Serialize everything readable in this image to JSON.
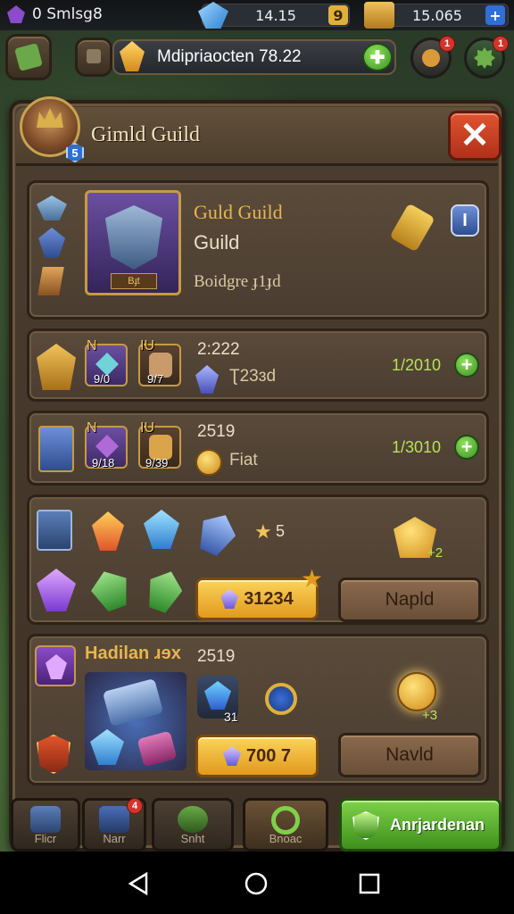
{
  "status_bar": {
    "left_text": "0 Smlsg8",
    "gems": "14.15",
    "gold": "15.065",
    "gem_plus": "9",
    "gold_plus": "+"
  },
  "top_banner": {
    "text": "Mdipriaocten 78.22"
  },
  "badges": {
    "mail": "1",
    "settings": "1"
  },
  "panel": {
    "title": "Gimld Guild",
    "avatar_level": "5",
    "close_label": "✕"
  },
  "guild_card": {
    "name": "Guld Guild",
    "type": "Guild",
    "badge_text": "Boidgre ɟ1ɟd",
    "emblem_label": "Bɟt",
    "info_label": "I"
  },
  "row1": {
    "item1_count": "9/0",
    "item2_count": "9/7",
    "item1_top": "N",
    "item2_top": "IU",
    "amount": "2:222",
    "sub": "Ʈ23ɜd",
    "progress": "1/2010"
  },
  "row2": {
    "item1_count": "9/18",
    "item2_count": "9/39",
    "item1_top": "N",
    "item2_top": "IU",
    "amount": "2519",
    "sub": "Fiat",
    "progress": "1/3010"
  },
  "row3": {
    "stars": "5",
    "reward_plus": "+2",
    "buy_value": "31234",
    "action": "Napld"
  },
  "row4": {
    "title": "Hadilan ɹɘx",
    "amount": "2519",
    "item_count": "31",
    "reward_plus": "+3",
    "buy_value": "700 7",
    "action": "Navld"
  },
  "bottom_nav": {
    "tab1": "Flicr",
    "tab2": "Narr",
    "tab3": "Snht",
    "tab4": "Bnoac",
    "tab2_badge": "4",
    "primary": "Anrjardenan"
  },
  "colors": {
    "panel": "#4b3d2f",
    "gold_text": "#e7b64c",
    "green_button": "#5db233",
    "close_red": "#c83e22"
  }
}
